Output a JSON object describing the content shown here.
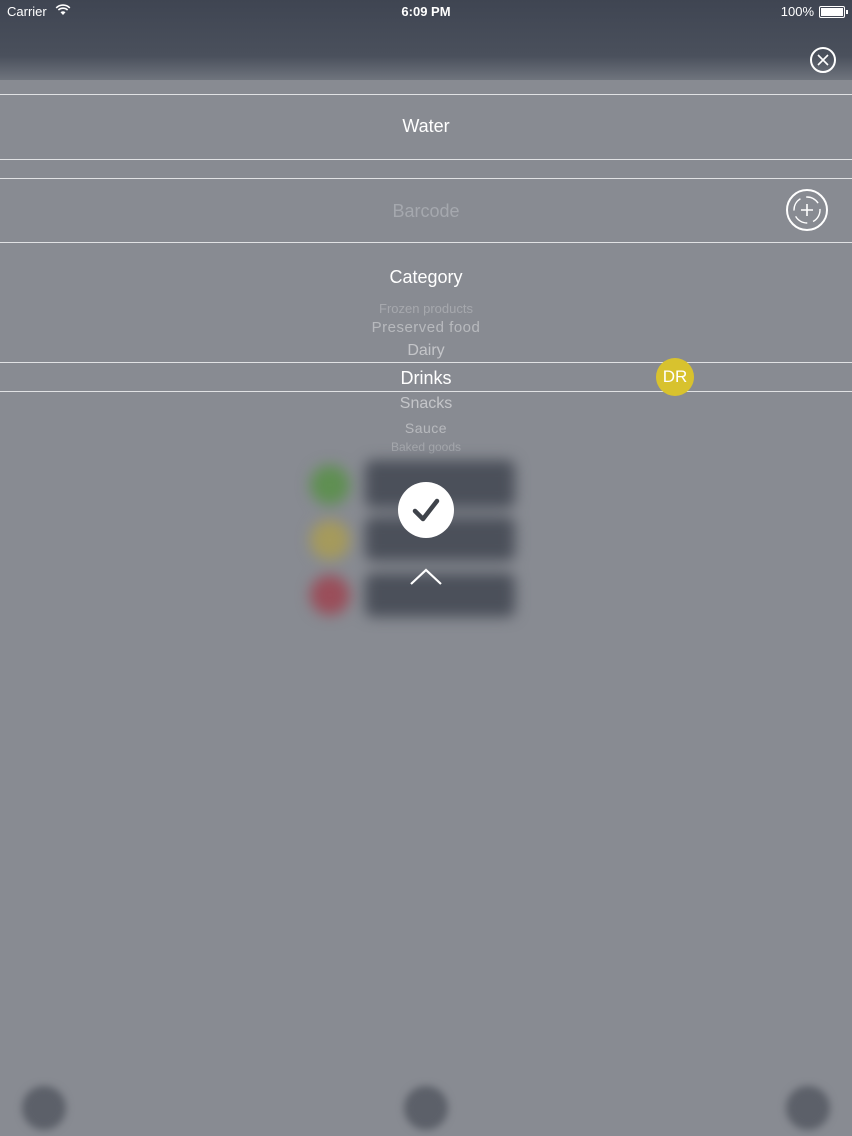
{
  "status_bar": {
    "carrier": "Carrier",
    "time": "6:09 PM",
    "battery": "100%"
  },
  "form": {
    "name_value": "Water",
    "barcode_placeholder": "Barcode",
    "category_title": "Category"
  },
  "category_picker": {
    "items": [
      "Frozen products",
      "Preserved food",
      "Dairy",
      "Drinks",
      "Snacks",
      "Sauce",
      "Baked goods"
    ],
    "selected": "Drinks"
  },
  "badge": {
    "text": "DR",
    "color": "#d8c22e"
  },
  "icons": {
    "close": "close-circle-icon",
    "scan": "barcode-scan-icon",
    "confirm": "checkmark-icon",
    "collapse": "chevron-up-icon"
  },
  "colors": {
    "overlay": "#888b92",
    "accent_yellow": "#d8c22e"
  }
}
